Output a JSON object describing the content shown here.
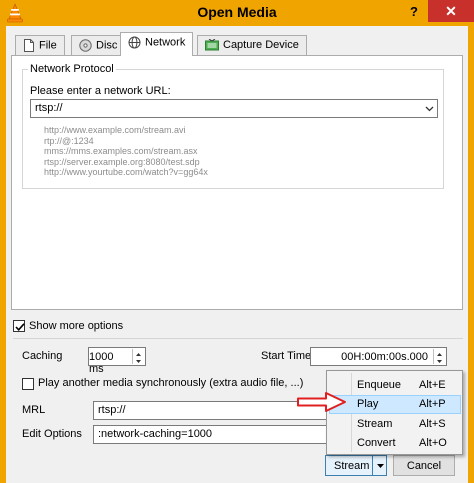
{
  "window": {
    "title": "Open Media",
    "help_glyph": "?",
    "close_glyph": "✕"
  },
  "tabs": [
    {
      "label": "File",
      "icon": "file-icon",
      "active": false
    },
    {
      "label": "Disc",
      "icon": "disc-icon",
      "active": false
    },
    {
      "label": "Network",
      "icon": "network-icon",
      "active": true
    },
    {
      "label": "Capture Device",
      "icon": "capture-device-icon",
      "active": false
    }
  ],
  "network": {
    "group_title": "Network Protocol",
    "prompt": "Please enter a network URL:",
    "url_value": "rtsp://",
    "examples": [
      "http://www.example.com/stream.avi",
      "rtp://@:1234",
      "mms://mms.examples.com/stream.asx",
      "rtsp://server.example.org:8080/test.sdp",
      "http://www.yourtube.com/watch?v=gg64x"
    ]
  },
  "options": {
    "show_more_label": "Show more options",
    "show_more_checked": true,
    "caching_label": "Caching",
    "caching_value": "1000 ms",
    "start_time_label": "Start Time",
    "start_time_value": "00H:00m:00s.000",
    "another_media_label": "Play another media synchronously (extra audio file, ...)",
    "another_media_checked": false,
    "mrl_label": "MRL",
    "mrl_value": "rtsp://",
    "edit_options_label": "Edit Options",
    "edit_options_value": ":network-caching=1000"
  },
  "buttons": {
    "stream_label": "Stream",
    "cancel_label": "Cancel"
  },
  "menu": {
    "items": [
      {
        "label": "Enqueue",
        "shortcut": "Alt+E"
      },
      {
        "label": "Play",
        "shortcut": "Alt+P",
        "highlighted": true
      },
      {
        "label": "Stream",
        "shortcut": "Alt+S"
      },
      {
        "label": "Convert",
        "shortcut": "Alt+O"
      }
    ]
  },
  "colors": {
    "title_bar": "#f0a400",
    "close_button": "#c7302b",
    "highlight": "#cde8ff",
    "annotation_arrow": "#e02020"
  }
}
